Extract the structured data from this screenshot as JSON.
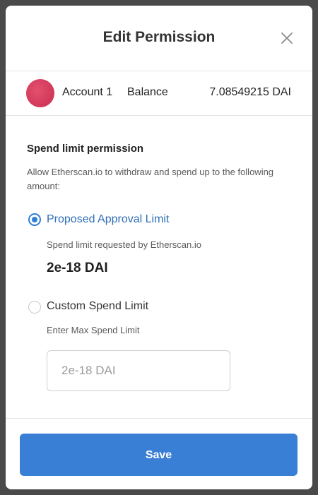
{
  "header": {
    "title": "Edit Permission",
    "close_icon": "close-icon"
  },
  "account": {
    "name": "Account 1",
    "balance_label": "Balance",
    "balance_value": "7.08549215 DAI",
    "avatar_color": "#d43a5c"
  },
  "permission": {
    "title": "Spend limit permission",
    "description": "Allow Etherscan.io to withdraw and spend up to the following amount:",
    "options": [
      {
        "label": "Proposed Approval Limit",
        "selected": true,
        "sub_text": "Spend limit requested by Etherscan.io",
        "amount": "2e-18 DAI"
      },
      {
        "label": "Custom Spend Limit",
        "selected": false,
        "sub_text": "Enter Max Spend Limit",
        "input_placeholder": "2e-18 DAI"
      }
    ]
  },
  "footer": {
    "save_label": "Save"
  },
  "colors": {
    "accent": "#3a7fd6",
    "selected_text": "#2f6fb5"
  }
}
